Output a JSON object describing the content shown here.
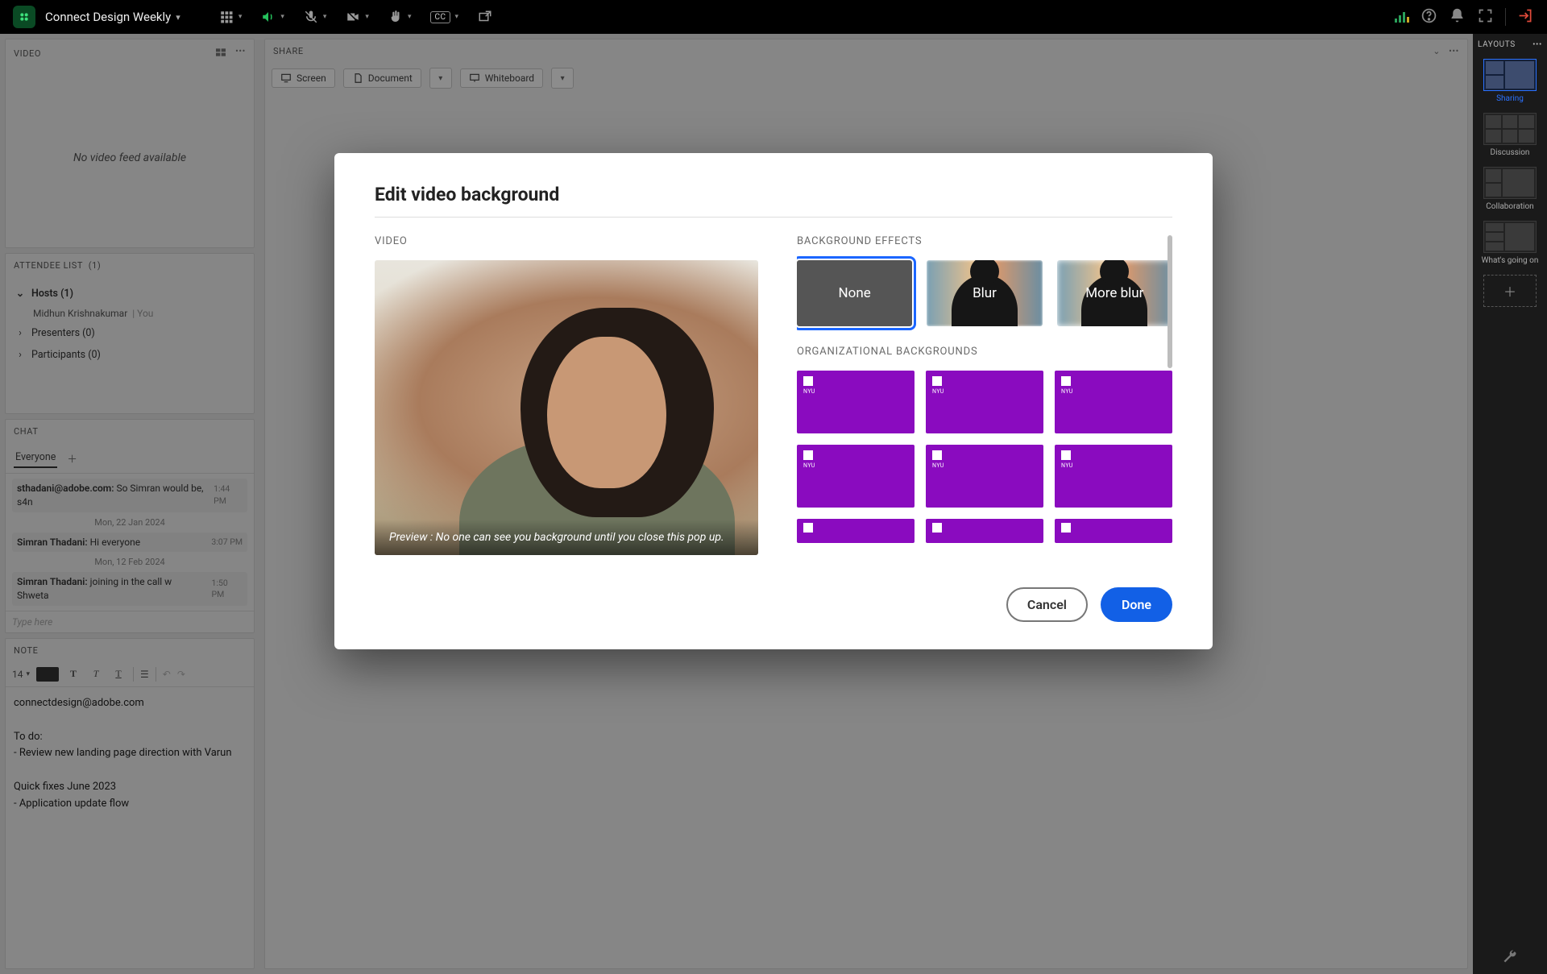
{
  "meeting_title": "Connect Design Weekly",
  "topbar_cc": "CC",
  "panels": {
    "video": {
      "title": "VIDEO",
      "empty_msg": "No video feed available"
    },
    "attendees": {
      "title": "ATTENDEE LIST",
      "count_suffix": "(1)",
      "hosts_label": "Hosts (1)",
      "host_name": "Midhun Krishnakumar",
      "you_suffix": "| You",
      "presenters_label": "Presenters (0)",
      "participants_label": "Participants (0)"
    },
    "chat": {
      "title": "CHAT",
      "tab": "Everyone",
      "placeholder": "Type here",
      "items": [
        {
          "who": "sthadani@adobe.com:",
          "text": "So Simran would be, s4n",
          "time": "1:44 PM"
        },
        {
          "sep": "Mon, 22 Jan 2024"
        },
        {
          "who": "Simran Thadani:",
          "text": "Hi everyone",
          "time": "3:07 PM"
        },
        {
          "sep": "Mon, 12 Feb 2024"
        },
        {
          "who": "Simran Thadani:",
          "text": "joining in the call w Shweta",
          "time": "1:50 PM"
        }
      ]
    },
    "note": {
      "title": "NOTE",
      "font_size": "14",
      "body_lines": [
        "connectdesign@adobe.com",
        "",
        "To do:",
        "- Review new landing page direction with Varun",
        "",
        "Quick fixes June 2023",
        "- Application update flow"
      ]
    },
    "share": {
      "title": "SHARE",
      "screen": "Screen",
      "document": "Document",
      "whiteboard": "Whiteboard"
    }
  },
  "layouts": {
    "title": "LAYOUTS",
    "items": [
      "Sharing",
      "Discussion",
      "Collaboration",
      "What's going on"
    ]
  },
  "modal": {
    "title": "Edit video background",
    "video_label": "VIDEO",
    "preview_caption": "Preview : No one can see you background until you close this pop up.",
    "bg_effects_label": "BACKGROUND EFFECTS",
    "bg_options": {
      "none": "None",
      "blur": "Blur",
      "more_blur": "More blur"
    },
    "org_label": "ORGANIZATIONAL BACKGROUNDS",
    "org_brand": "NYU",
    "cancel": "Cancel",
    "done": "Done"
  }
}
